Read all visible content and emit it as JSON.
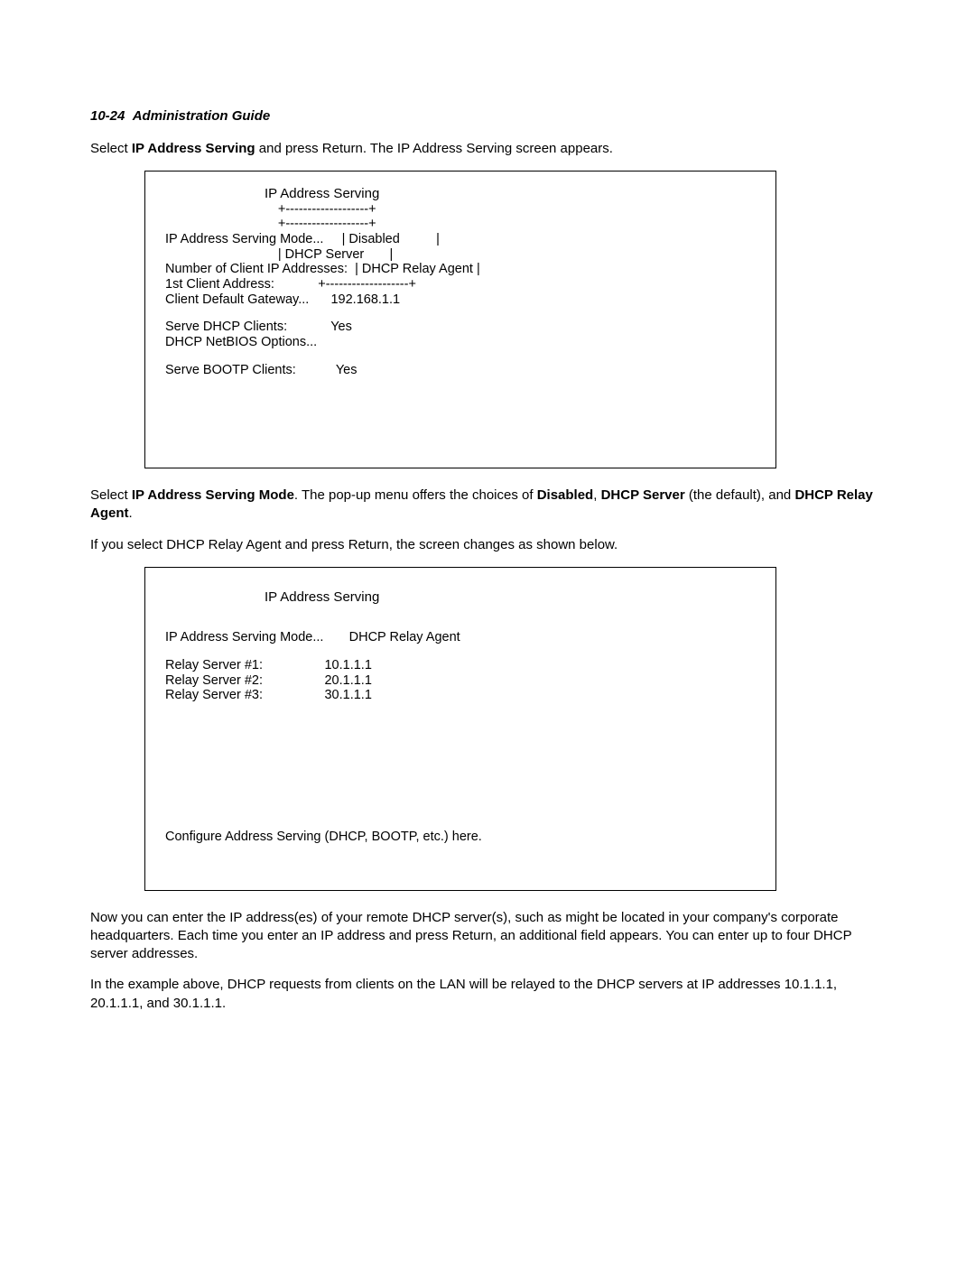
{
  "header": {
    "page_ref": "10-24",
    "title": "Administration Guide"
  },
  "intro1": {
    "prefix": "Select ",
    "bold": "IP Address Serving",
    "suffix": " and press Return. The IP Address Serving screen appears."
  },
  "screen1": {
    "title": "IP Address Serving",
    "rule_top": "                               +-------------------+",
    "rule_top2": "                               +-------------------+",
    "mode_line": "IP Address Serving Mode...     | Disabled          |",
    "dhcpserver_line": "                               | DHCP Server       |",
    "numclients_line": "Number of Client IP Addresses:  | DHCP Relay Agent |",
    "firstclient_line": "1st Client Address:            +-------------------+",
    "gateway_line": "Client Default Gateway...      192.168.1.1",
    "serve_dhcp_line": "Serve DHCP Clients:            Yes",
    "netbios_line": "DHCP NetBIOS Options...",
    "serve_bootp_line": "Serve BOOTP Clients:           Yes"
  },
  "para2": {
    "p1": "Select ",
    "b1": "IP Address Serving Mode",
    "p2": ". The pop-up menu offers the choices of ",
    "b2": "Disabled",
    "p3": ", ",
    "b3": "DHCP Server",
    "p4": " (the default), and ",
    "b4": "DHCP Relay Agent",
    "p5": "."
  },
  "para3": "If you select DHCP Relay Agent and press Return, the screen changes as shown below.",
  "screen2": {
    "title": "IP Address Serving",
    "mode_line": "IP Address Serving Mode...       DHCP Relay Agent",
    "rs1": "Relay Server #1:                 10.1.1.1",
    "rs2": "Relay Server #2:                 20.1.1.1",
    "rs3": "Relay Server #3:                 30.1.1.1",
    "footer": "Configure Address Serving (DHCP, BOOTP, etc.) here."
  },
  "para4": "Now you can enter the IP address(es) of your remote DHCP server(s), such as might be located in your company's corporate headquarters. Each time you enter an IP address and press Return, an additional field appears. You can enter up to four DHCP server addresses.",
  "para5": "In the example above, DHCP requests from clients on the LAN will be relayed to the DHCP servers at IP addresses 10.1.1.1, 20.1.1.1, and 30.1.1.1."
}
